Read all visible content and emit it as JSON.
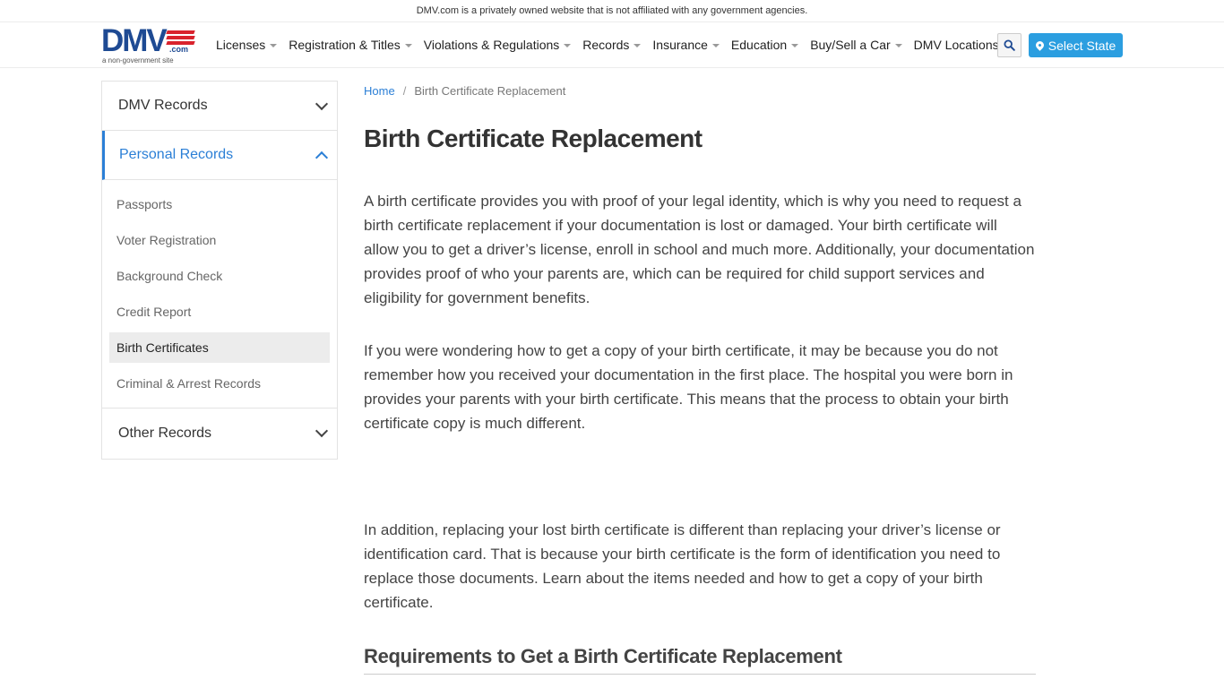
{
  "notice": "DMV.com is a privately owned website that is not affiliated with any government agencies.",
  "logo": {
    "main": "DMV",
    "com": ".com",
    "sub": "a non-government site"
  },
  "nav": [
    {
      "label": "Licenses"
    },
    {
      "label": "Registration & Titles"
    },
    {
      "label": "Violations & Regulations"
    },
    {
      "label": "Records"
    },
    {
      "label": "Insurance"
    },
    {
      "label": "Education"
    },
    {
      "label": "Buy/Sell a Car"
    },
    {
      "label": "DMV Locations"
    }
  ],
  "select_state": "Select State",
  "sidebar": {
    "sections": [
      {
        "label": "DMV Records"
      },
      {
        "label": "Personal Records"
      },
      {
        "label": "Other Records"
      }
    ],
    "links": [
      {
        "label": "Passports"
      },
      {
        "label": "Voter Registration"
      },
      {
        "label": "Background Check"
      },
      {
        "label": "Credit Report"
      },
      {
        "label": "Birth Certificates"
      },
      {
        "label": "Criminal & Arrest Records"
      }
    ]
  },
  "breadcrumb": {
    "home": "Home",
    "sep": "/",
    "current": "Birth Certificate Replacement"
  },
  "content": {
    "title": "Birth Certificate Replacement",
    "p1": "A birth certificate provides you with proof of your legal identity, which is why you need to request a birth certificate replacement if your documentation is lost or damaged. Your birth certificate will allow you to get a driver’s license, enroll in school and much more. Additionally, your documentation provides proof of who your parents are, which can be required for child support services and eligibility for government benefits.",
    "p2": "If you were wondering how to get a copy of your birth certificate, it may be because you do not remember how you received your documentation in the first place. The hospital you were born in provides your parents with your birth certificate. This means that the process to obtain your birth certificate copy is much different.",
    "p3": "In addition, replacing your lost birth certificate is different than replacing your driver’s license or identification card. That is because your birth certificate is the form of identification you need to replace those documents. Learn about the items needed and how to get a copy of your birth certificate.",
    "h2": "Requirements to Get a Birth Certificate Replacement"
  }
}
